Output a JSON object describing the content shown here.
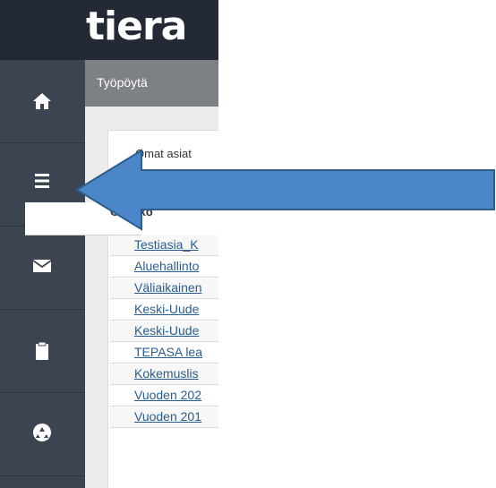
{
  "app": {
    "logo_text": "tiera"
  },
  "sidebar": {
    "items": [
      {
        "icon": "home-icon"
      },
      {
        "icon": "menu-icon"
      },
      {
        "icon": "mail-icon"
      },
      {
        "icon": "clipboard-icon"
      },
      {
        "icon": "recycle-icon"
      }
    ]
  },
  "tab": {
    "title": "Työpöytä"
  },
  "panel": {
    "title": "Omat asiat",
    "column_header": "Otsikko",
    "rows": [
      "Testiasia_K",
      "Aluehallinto",
      "Väliaikainen",
      "Keski-Uude",
      "Keski-Uude",
      "TEPASA lea",
      "Kokemuslis",
      "Vuoden 202",
      "Vuoden 201"
    ]
  },
  "annotation": {
    "arrow_color": "#4a86c8",
    "arrow_stroke": "#2e5e8c"
  },
  "colors": {
    "topbar": "#242a35",
    "sidebar": "#3d4451",
    "tabbar": "#7d8085",
    "link": "#2a5d8f"
  }
}
